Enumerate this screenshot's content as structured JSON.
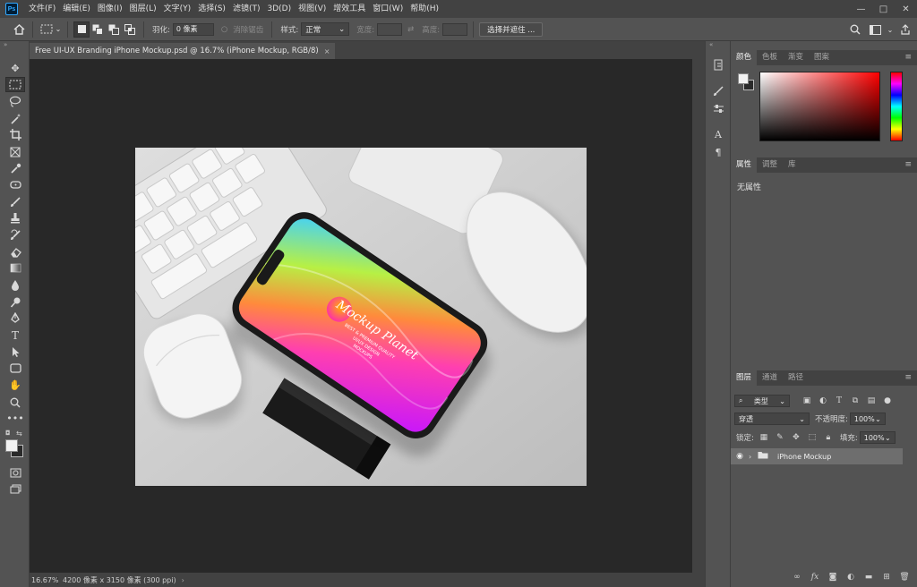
{
  "app": {
    "logo": "Ps"
  },
  "menu": [
    "文件(F)",
    "编辑(E)",
    "图像(I)",
    "图层(L)",
    "文字(Y)",
    "选择(S)",
    "滤镜(T)",
    "3D(D)",
    "视图(V)",
    "增效工具",
    "窗口(W)",
    "帮助(H)"
  ],
  "window_controls": {
    "minimize": "—",
    "maximize": "□",
    "close": "✕"
  },
  "options": {
    "feather_label": "羽化:",
    "feather_value": "0 像素",
    "antialias_label": "消除锯齿",
    "style_label": "样式:",
    "style_value": "正常",
    "width_label": "宽度:",
    "height_label": "高度:",
    "select_mask_button": "选择并遮住 ..."
  },
  "document": {
    "tab_title": "Free UI-UX Branding iPhone Mockup.psd @ 16.7% (iPhone Mockup, RGB/8)",
    "close": "×"
  },
  "status": {
    "zoom": "16.67%",
    "size": "4200 像素 x 3150 像素 (300 ppi)",
    "arrow": "›"
  },
  "mockup_text": {
    "brand": "Mockup Planet",
    "line1": "BEST & PREMIUM QUALITY",
    "line2": "UI/UX DESIGN",
    "line3": "MOCKUPS"
  },
  "panels": {
    "color": {
      "tabs": [
        "颜色",
        "色板",
        "渐变",
        "图案"
      ],
      "fg_color": "#f2f2f2",
      "bg_color": "#2a2a2a"
    },
    "properties": {
      "tabs": [
        "属性",
        "调整",
        "库"
      ],
      "empty_text": "无属性"
    },
    "layers": {
      "tabs": [
        "图层",
        "通道",
        "路径"
      ],
      "filter_type": "类型",
      "blend_mode": "穿透",
      "opacity_label": "不透明度:",
      "opacity_value": "100%",
      "lock_label": "锁定:",
      "fill_label": "填充:",
      "fill_value": "100%",
      "layer_name": "iPhone Mockup"
    }
  },
  "colors": {
    "accent": "#31a8ff",
    "canvas_bg": "#282828",
    "ui_bg": "#535353"
  }
}
